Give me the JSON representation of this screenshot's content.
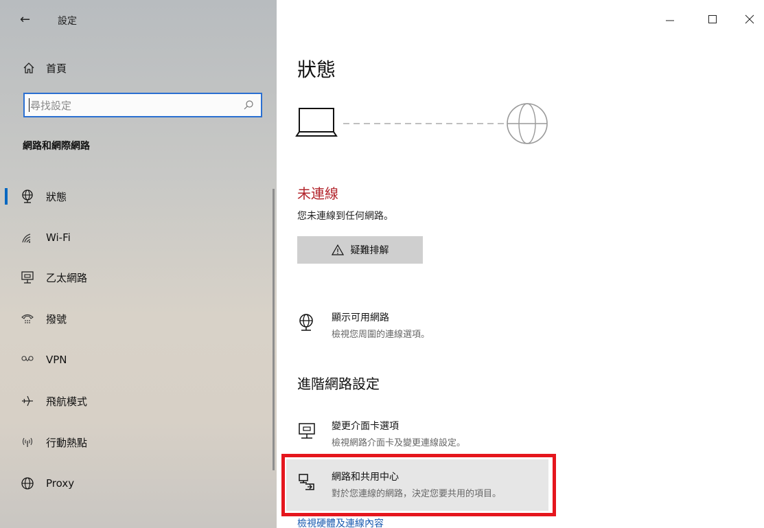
{
  "window": {
    "app_title": "設定",
    "controls": {
      "minimize": "–",
      "maximize": "☐",
      "close": "✕"
    }
  },
  "sidebar": {
    "home_label": "首頁",
    "search_placeholder": "尋找設定",
    "section_title": "網路和網際網路",
    "items": [
      {
        "label": "狀態",
        "icon": "globe-network-icon",
        "selected": true
      },
      {
        "label": "Wi-Fi",
        "icon": "wifi-icon",
        "selected": false
      },
      {
        "label": "乙太網路",
        "icon": "ethernet-icon",
        "selected": false
      },
      {
        "label": "撥號",
        "icon": "dialup-phone-icon",
        "selected": false
      },
      {
        "label": "VPN",
        "icon": "vpn-icon",
        "selected": false
      },
      {
        "label": "飛航模式",
        "icon": "airplane-icon",
        "selected": false
      },
      {
        "label": "行動熱點",
        "icon": "hotspot-icon",
        "selected": false
      },
      {
        "label": "Proxy",
        "icon": "proxy-globe-icon",
        "selected": false
      }
    ]
  },
  "main": {
    "page_title": "狀態",
    "status": {
      "title": "未連線",
      "description": "您未連線到任何網路。",
      "status_color": "#b3262d"
    },
    "troubleshoot_label": "疑難排解",
    "show_networks": {
      "title": "顯示可用網路",
      "subtitle": "檢視您周圍的連線選項。"
    },
    "advanced_title": "進階網路設定",
    "change_adapter": {
      "title": "變更介面卡選項",
      "subtitle": "檢視網路介面卡及變更連線設定。"
    },
    "sharing_center": {
      "title": "網路和共用中心",
      "subtitle": "對於您連線的網路，決定您要共用的項目。"
    },
    "cut_link": "檢視硬體及連線內容"
  },
  "colors": {
    "accent": "#0067c0",
    "highlight_frame": "#e5161d",
    "link": "#1a5bb0"
  }
}
